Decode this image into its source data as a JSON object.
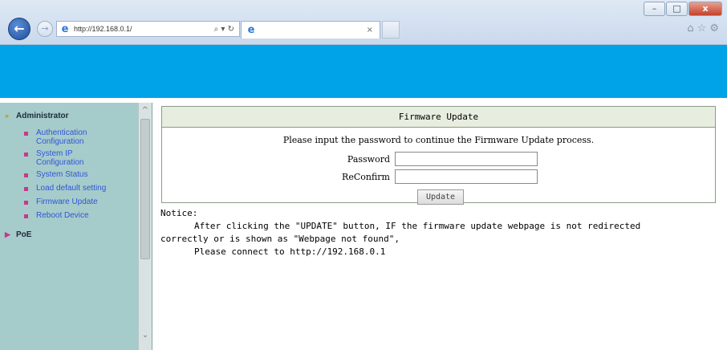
{
  "browser": {
    "url": "http://192.168.0.1/",
    "address_tools": "⌕ ▾ ↻",
    "tab_title": "",
    "tab_close": "×",
    "window_buttons": {
      "minimize": "–",
      "maximize": "□",
      "close": "x"
    },
    "icons": [
      "home-icon",
      "star-icon",
      "gear-icon"
    ]
  },
  "colors": {
    "banner": "#00a2e8",
    "sidebar_bg": "#a6cbcb",
    "link": "#2f57d6",
    "panel_header": "#e7eddf"
  },
  "sidebar": {
    "groups": [
      {
        "label": "Administrator",
        "items": [
          "Authentication Configuration",
          "System IP Configuration",
          "System Status",
          "Load default setting",
          "Firmware Update",
          "Reboot Device"
        ]
      },
      {
        "label": "PoE",
        "items": []
      }
    ]
  },
  "firmware": {
    "title": "Firmware Update",
    "prompt": "Please input the password to continue the Firmware Update process.",
    "password_label": "Password",
    "password_value": "",
    "reconfirm_label": "ReConfirm",
    "reconfirm_value": "",
    "update_button": "Update"
  },
  "notice": {
    "heading": "Notice:",
    "line1": "After clicking the \"UPDATE\" button, IF the firmware update webpage is not redirected",
    "line2": "correctly or is shown as \"Webpage not found\",",
    "line3": "Please connect to http://192.168.0.1"
  }
}
